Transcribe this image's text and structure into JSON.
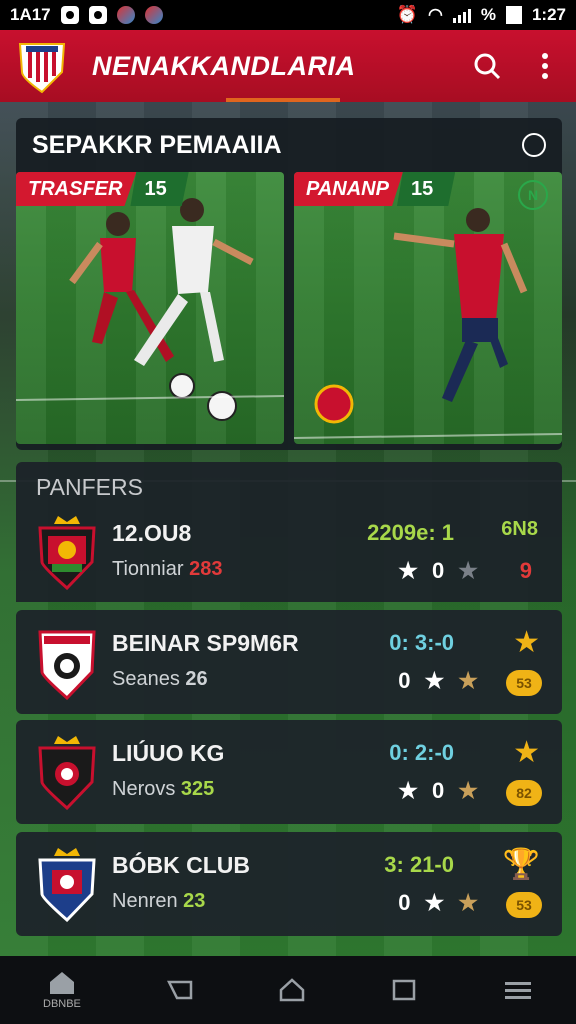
{
  "status_bar": {
    "left_text": "1A17",
    "right_time": "1:27",
    "percent": "%"
  },
  "app_bar": {
    "title": "NENAKKANDLARIA",
    "icons": [
      "crest-logo",
      "search-icon",
      "more-vert-icon"
    ]
  },
  "featured": {
    "title": "SEPAKKR PEMAAIIA",
    "cards": [
      {
        "tag": "TRASFER",
        "number": "15"
      },
      {
        "tag": "PANANP",
        "number": "15",
        "corner": "N"
      }
    ]
  },
  "players": {
    "section_title": "PANFERS",
    "items": [
      {
        "name": "12.OU8",
        "sub_label": "Tionniar",
        "sub_value": "283",
        "score": "2209e: 1",
        "extra": "6N8",
        "stars_value": "0",
        "right_value": "9",
        "score_color": "#a8d84a",
        "sub_value_color": "#e23a3a"
      },
      {
        "name": "BEINAR SP9M6R",
        "sub_label": "Seanes",
        "sub_value": "26",
        "score": "0: 3:-0",
        "stars_value": "0",
        "coin": "53",
        "score_color": "#6fd0e0",
        "sub_value_color": "#cfd3d6"
      },
      {
        "name": "LIÚUO KG",
        "sub_label": "Nerovs",
        "sub_value": "325",
        "score": "0: 2:-0",
        "stars_value": "0",
        "coin": "82",
        "score_color": "#6fd0e0",
        "sub_value_color": "#a8d84a"
      },
      {
        "name": "BÓBK CLUB",
        "sub_label": "Nenren",
        "sub_value": "23",
        "score": "3: 21-0",
        "stars_value": "0",
        "coin": "53",
        "score_color": "#a8d84a",
        "sub_value_color": "#a8d84a"
      }
    ]
  },
  "bottom_nav": {
    "home_caption": "DBNBE",
    "items": [
      "home-icon",
      "back-icon",
      "home-outline-icon",
      "recents-icon",
      "menu-icon"
    ]
  }
}
